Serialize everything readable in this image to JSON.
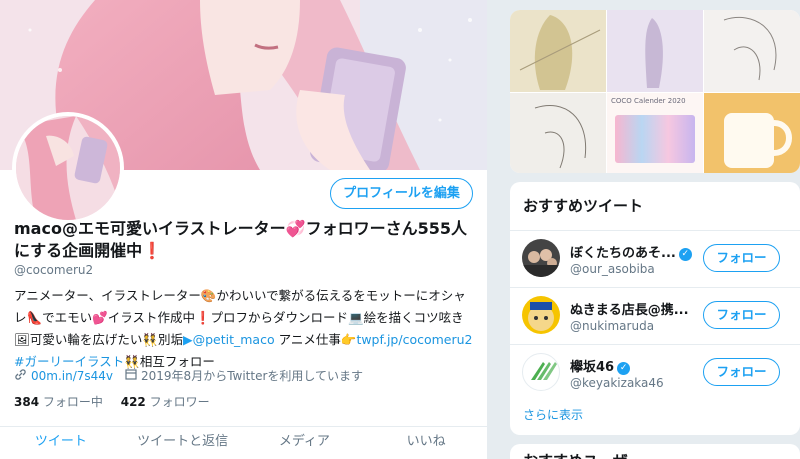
{
  "profile": {
    "edit_button": "プロフィールを編集",
    "display_name_1": "maco@エモ可愛いイラストレーター",
    "display_name_2": "フォロワーさん555人にする企画開催中",
    "handle": "@cocomeru2",
    "bio_1": "アニメーター、イラストレーター",
    "bio_2": "かわいいで繋がる伝えるをモットーにオシャレ",
    "bio_3": "でエモい",
    "bio_4": "イラスト作成中",
    "bio_5": "プロフからダウンロード",
    "bio_6": "絵を描くコツ呟き",
    "bio_7": "可愛い輪を広げたい",
    "bio_8": "別垢",
    "bio_mention": "@petit_maco",
    "bio_9": " アニメ仕事",
    "bio_link": "twpf.jp/cocomeru2",
    "bio_hashtag": " #ガーリーイラスト",
    "bio_10": "相互フォロー",
    "website": "00m.in/7s44v",
    "joined": "2019年8月からTwitterを利用しています",
    "following_count": "384",
    "following_label": "フォロー中",
    "followers_count": "422",
    "followers_label": "フォロワー",
    "tabs": [
      "ツイート",
      "ツイートと返信",
      "メディア",
      "いいね"
    ]
  },
  "media": {
    "calendar_text": "COCO Calender 2020"
  },
  "recommended": {
    "title": "おすすめツイート",
    "show_more": "さらに表示",
    "follow_label": "フォロー",
    "items": [
      {
        "name": "ぼくたちのあそ...",
        "handle": "@our_asobiba"
      },
      {
        "name": "ぬきまる店長@携...",
        "handle": "@nukimaruda"
      },
      {
        "name": "欅坂46",
        "handle": "@keyakizaka46"
      }
    ]
  },
  "next_card": {
    "title": "おすすめユーザー"
  },
  "colors": {
    "accent": "#1da1f2",
    "link": "#1b95e0",
    "muted": "#657786",
    "bg": "#e6ecf0"
  }
}
